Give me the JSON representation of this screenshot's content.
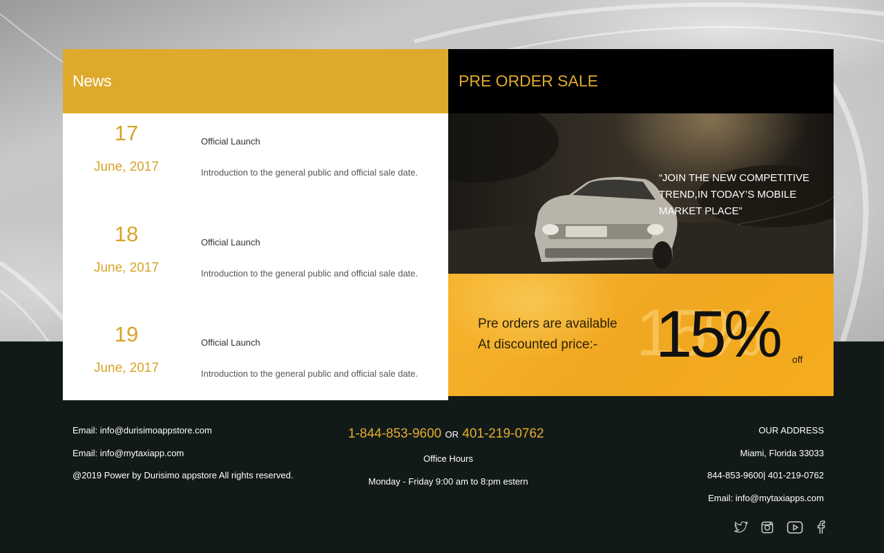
{
  "news": {
    "title": "News",
    "items": [
      {
        "day": "17",
        "month": "June, 2017",
        "headline": "Official Launch",
        "description": "Introduction to the general public and official sale date."
      },
      {
        "day": "18",
        "month": "June, 2017",
        "headline": "Official Launch",
        "description": "Introduction to the general public and official sale date."
      },
      {
        "day": "19",
        "month": "June, 2017",
        "headline": "Official Launch",
        "description": "Introduction to the general public and official sale date."
      }
    ]
  },
  "preorder": {
    "title": "PRE ORDER SALE",
    "quote": "“JOIN THE NEW COMPETITIVE TREND,IN TODAY’S MOBILE MARKET PLACE”",
    "offer_line1": "Pre orders are available",
    "offer_line2": "At discounted price:-",
    "percent": "15%",
    "off": "off"
  },
  "footer": {
    "email1": "Email: info@durisimoappstore.com",
    "email2": "Email: info@mytaxiapp.com",
    "copyright": "@2019 Power by Durisimo appstore All rights reserved.",
    "phone1": "1-844-853-9600",
    "or": "OR",
    "phone2": "401-219-0762",
    "office_hours_label": "Office Hours",
    "office_hours": "Monday - Friday 9:00 am to 8:pm estern",
    "address_title": "OUR ADDRESS",
    "address_city": "Miami, Florida 33033",
    "address_phones": "844-853-9600| 401-219-0762",
    "address_email": "Email: info@mytaxiapps.com",
    "social": [
      "twitter-icon",
      "instagram-icon",
      "youtube-icon",
      "facebook-icon"
    ]
  },
  "colors": {
    "accent": "#dfaa2b",
    "offer_bg": "#f5ac1d",
    "footer_bg": "#121a19"
  }
}
